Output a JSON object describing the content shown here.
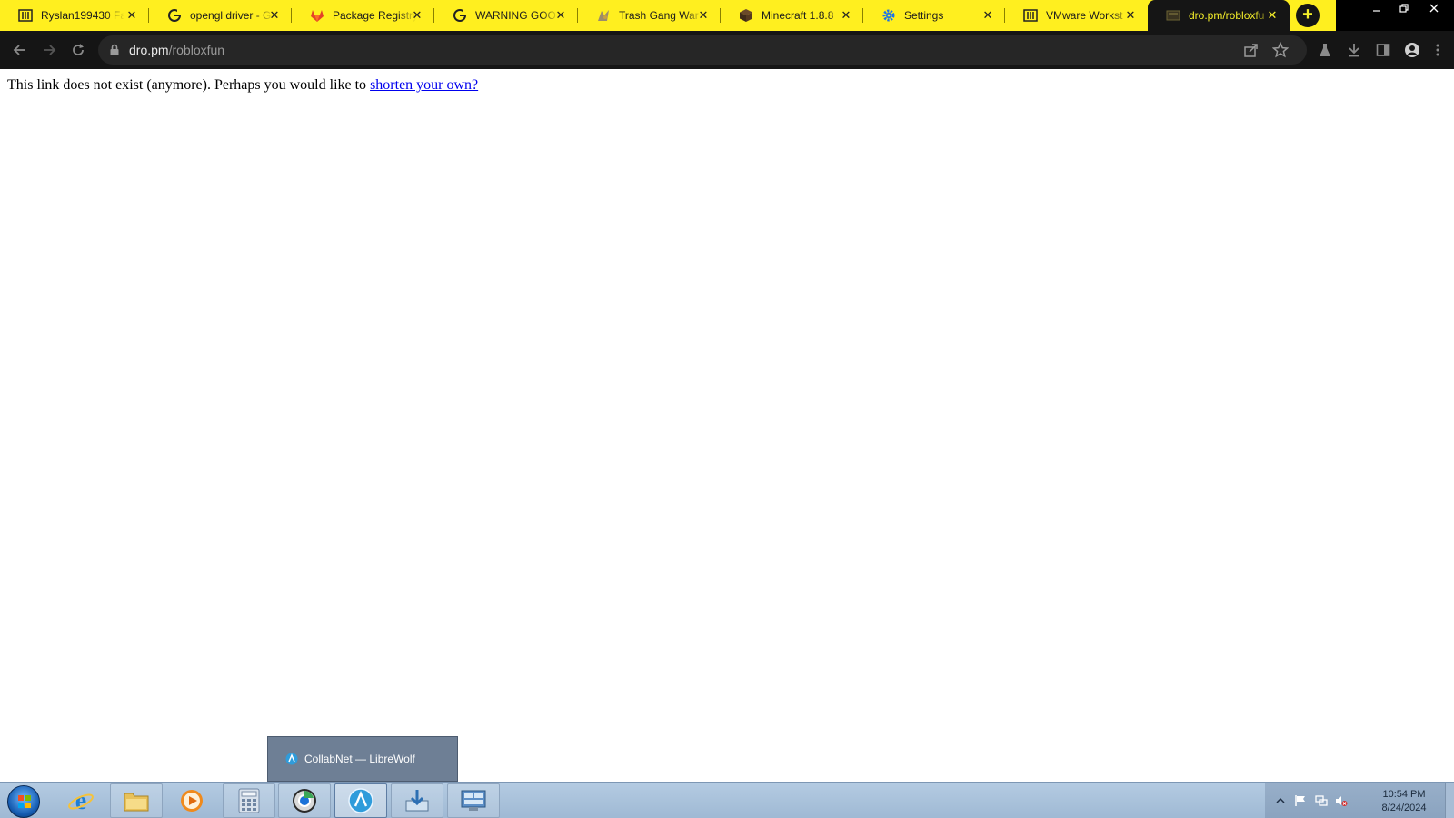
{
  "browser": {
    "tabs": [
      {
        "title": "Ryslan199430 Fa",
        "icon": "library-icon",
        "active": false
      },
      {
        "title": "opengl driver - G",
        "icon": "google-icon",
        "active": false
      },
      {
        "title": "Package Registry",
        "icon": "gitlab-icon",
        "active": false
      },
      {
        "title": "WARNING GOO",
        "icon": "google-icon",
        "active": false
      },
      {
        "title": "Trash Gang War",
        "icon": "game-icon",
        "active": false
      },
      {
        "title": "Minecraft 1.8.8",
        "icon": "minecraft-icon",
        "active": false
      },
      {
        "title": "Settings",
        "icon": "gear-icon",
        "active": false
      },
      {
        "title": "VMware Workst",
        "icon": "library-icon",
        "active": false
      },
      {
        "title": "dro.pm/robloxfu",
        "icon": "page-icon",
        "active": true
      }
    ],
    "new_tab_label": "+",
    "close_glyph": "✕",
    "address": {
      "host": "dro.pm",
      "path": "/robloxfun"
    }
  },
  "page": {
    "message": "This link does not exist (anymore). Perhaps you would like to ",
    "link_text": "shorten your own?"
  },
  "taskbar": {
    "preview_title": "CollabNet — LibreWolf",
    "apps": [
      {
        "name": "internet-explorer-icon",
        "state": "pinned"
      },
      {
        "name": "file-explorer-icon",
        "state": "open"
      },
      {
        "name": "media-player-icon",
        "state": "pinned"
      },
      {
        "name": "calculator-icon",
        "state": "open"
      },
      {
        "name": "chrome-icon",
        "state": "open"
      },
      {
        "name": "librewolf-icon",
        "state": "active"
      },
      {
        "name": "downloads-icon",
        "state": "open"
      },
      {
        "name": "control-panel-icon",
        "state": "open"
      }
    ],
    "clock": {
      "time": "10:54 PM",
      "date": "8/24/2024"
    }
  },
  "colors": {
    "tabstrip": "#ffef1f",
    "toolbar": "#151515",
    "active_tab_text": "#f5ef2a",
    "link": "#0000ee",
    "taskbar": "#a9c1da"
  }
}
